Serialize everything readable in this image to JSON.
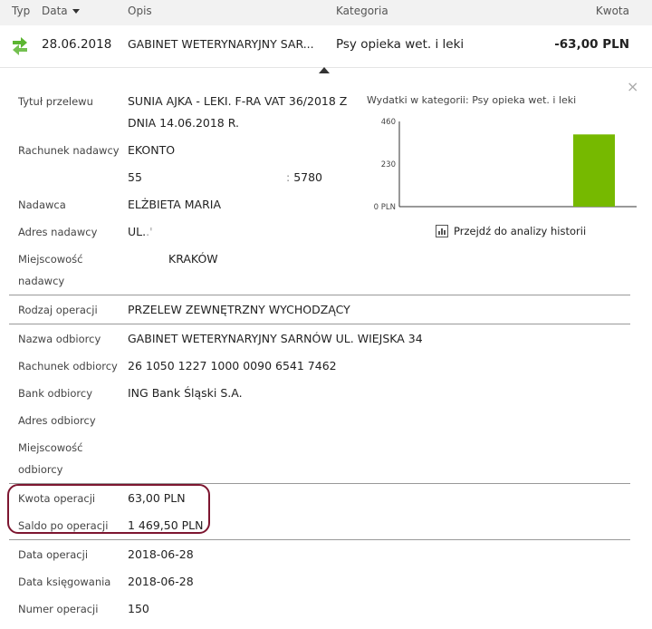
{
  "header": {
    "col_type": "Typ",
    "col_date": "Data",
    "col_desc": "Opis",
    "col_category": "Kategoria",
    "col_amount": "Kwota"
  },
  "transaction": {
    "type_icon": "transfer-arrows-icon",
    "date": "28.06.2018",
    "description": "GABINET WETERYNARYJNY SAR...",
    "category": "Psy opieka wet. i leki",
    "amount": "-63,00 PLN"
  },
  "details": {
    "title_label": "Tytuł przelewu",
    "title_line1": "SUNIA AJKA - LEKI. F-RA VAT 36/2018 Z",
    "title_line2": "DNIA 14.06.2018 R.",
    "sender_account_label": "Rachunek nadawcy",
    "sender_account_name": "EKONTO",
    "sender_account_start": "55",
    "sender_account_end": "5780",
    "sender_label": "Nadawca",
    "sender_value": "ELŻBIETA MARIA",
    "sender_address_label": "Adres nadawcy",
    "sender_address_value": "UL.",
    "sender_city_label_1": "Miejscowość",
    "sender_city_label_2": "nadawcy",
    "sender_city_value": "KRAKÓW",
    "operation_type_label": "Rodzaj operacji",
    "operation_type_value": "PRZELEW ZEWNĘTRZNY WYCHODZĄCY",
    "recipient_name_label": "Nazwa odbiorcy",
    "recipient_name_value": "GABINET WETERYNARYJNY SARNÓW UL. WIEJSKA 34",
    "recipient_account_label": "Rachunek odbiorcy",
    "recipient_account_value": "26 1050 1227 1000 0090 6541 7462",
    "recipient_bank_label": "Bank odbiorcy",
    "recipient_bank_value": "ING Bank Śląski S.A.",
    "recipient_address_label": "Adres odbiorcy",
    "recipient_city_label_1": "Miejscowość",
    "recipient_city_label_2": "odbiorcy",
    "amount_label": "Kwota operacji",
    "amount_value": "63,00 PLN",
    "balance_label": "Saldo po operacji",
    "balance_value": "1 469,50 PLN",
    "op_date_label": "Data operacji",
    "op_date_value": "2018-06-28",
    "booking_date_label": "Data księgowania",
    "booking_date_value": "2018-06-28",
    "op_number_label": "Numer operacji",
    "op_number_value": "150"
  },
  "category_chart": {
    "title": "Wydatki w kategorii:  Psy opieka wet. i leki",
    "history_link": "Przejdź do analizy historii",
    "history_icon": "bar-chart-icon"
  },
  "chart_data": {
    "type": "bar",
    "title": "Wydatki w kategorii:  Psy opieka wet. i leki",
    "categories": [
      "",
      ""
    ],
    "values": [
      0,
      390
    ],
    "ylim": [
      0,
      460
    ],
    "yticks": [
      {
        "value": 460,
        "label": "460"
      },
      {
        "value": 230,
        "label": "230"
      },
      {
        "value": 0,
        "label": "0 PLN"
      }
    ],
    "bar_color": "#76b900",
    "grid": false,
    "legend": "none"
  },
  "colors": {
    "highlight_border": "#7d1630",
    "icon_green": "#5cb531",
    "bar_green": "#76b900"
  }
}
